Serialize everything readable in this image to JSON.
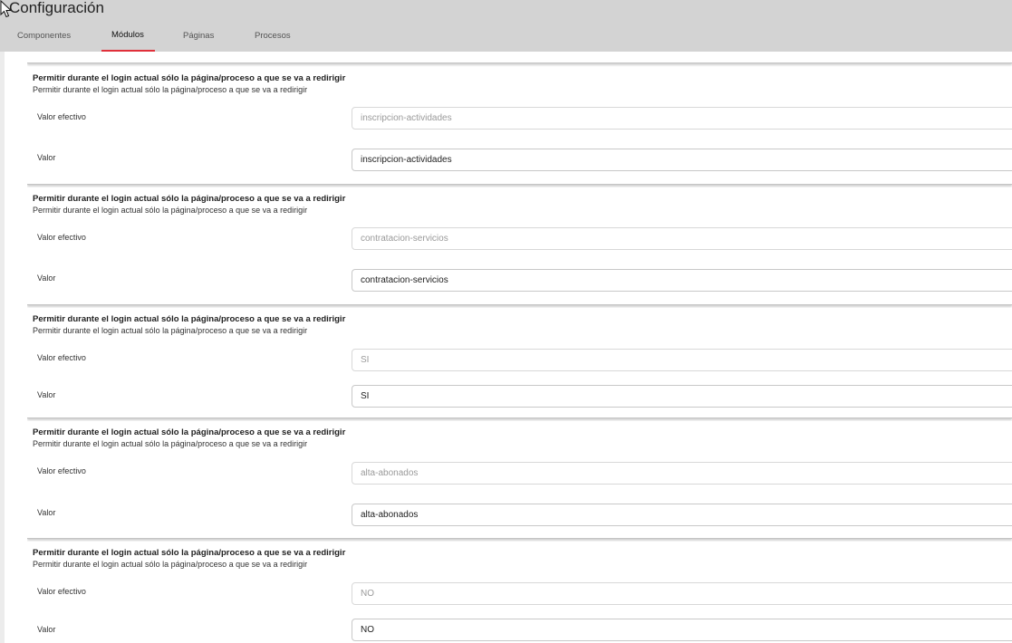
{
  "header": {
    "title": "Configuración",
    "tabs": [
      {
        "label": "Componentes",
        "active": false
      },
      {
        "label": "Módulos",
        "active": true
      },
      {
        "label": "Páginas",
        "active": false
      },
      {
        "label": "Procesos",
        "active": false
      }
    ],
    "accent_color": "#e0303a"
  },
  "settings": [
    {
      "title": "Permitir durante el login actual sólo la página/proceso a que se va a redirigir",
      "description": "Permitir durante el login actual sólo la página/proceso a que se va a redirigir",
      "effective_label": "Valor efectivo",
      "effective_value": "inscripcion-actividades",
      "value_label": "Valor",
      "value": "inscripcion-actividades"
    },
    {
      "title": "Permitir durante el login actual sólo la página/proceso a que se va a redirigir",
      "description": "Permitir durante el login actual sólo la página/proceso a que se va a redirigir",
      "effective_label": "Valor efectivo",
      "effective_value": "contratacion-servicios",
      "value_label": "Valor",
      "value": "contratacion-servicios"
    },
    {
      "title": "Permitir durante el login actual sólo la página/proceso a que se va a redirigir",
      "description": "Permitir durante el login actual sólo la página/proceso a que se va a redirigir",
      "effective_label": "Valor efectivo",
      "effective_value": "SI",
      "value_label": "Valor",
      "value": "SI"
    },
    {
      "title": "Permitir durante el login actual sólo la página/proceso a que se va a redirigir",
      "description": "Permitir durante el login actual sólo la página/proceso a que se va a redirigir",
      "effective_label": "Valor efectivo",
      "effective_value": "alta-abonados",
      "value_label": "Valor",
      "value": "alta-abonados"
    },
    {
      "title": "Permitir durante el login actual sólo la página/proceso a que se va a redirigir",
      "description": "Permitir durante el login actual sólo la página/proceso a que se va a redirigir",
      "effective_label": "Valor efectivo",
      "effective_value": "NO",
      "value_label": "Valor",
      "value": "NO"
    }
  ]
}
